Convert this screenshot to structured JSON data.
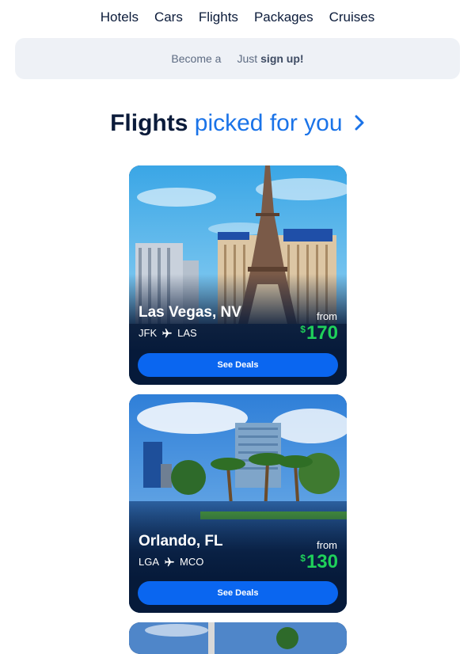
{
  "nav": {
    "items": [
      {
        "label": "Hotels"
      },
      {
        "label": "Cars"
      },
      {
        "label": "Flights"
      },
      {
        "label": "Packages"
      },
      {
        "label": "Cruises"
      }
    ]
  },
  "banner": {
    "text_a": "Become a",
    "text_b": "Just",
    "link": "sign up!"
  },
  "heading": {
    "bold": "Flights",
    "rest": "picked for you"
  },
  "cards": [
    {
      "city": "Las Vegas, NV",
      "origin": "JFK",
      "destination": "LAS",
      "from_label": "from",
      "currency": "$",
      "price": "170",
      "button": "See Deals"
    },
    {
      "city": "Orlando, FL",
      "origin": "LGA",
      "destination": "MCO",
      "from_label": "from",
      "currency": "$",
      "price": "130",
      "button": "See Deals"
    }
  ],
  "colors": {
    "accent": "#1a73e8",
    "button": "#0a66f0",
    "price": "#1fd15a",
    "card_bg": "#061a3a"
  }
}
